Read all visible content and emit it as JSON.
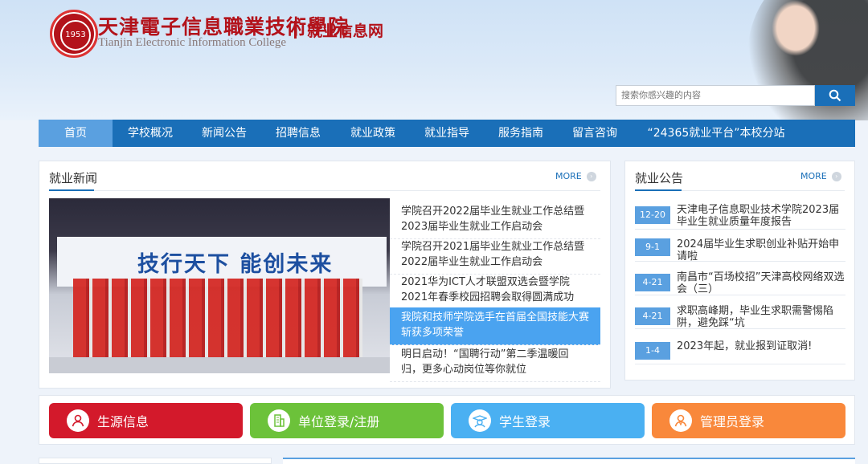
{
  "header": {
    "title_cn": "天津電子信息職業技術學院",
    "title_en": "Tianjin Electronic Information College",
    "subtitle": "就业信息网",
    "logo_year": "1953"
  },
  "search": {
    "placeholder": "搜索你感兴趣的内容",
    "icon": "search-icon"
  },
  "nav": {
    "items": [
      {
        "label": "首页",
        "active": true
      },
      {
        "label": "学校概况"
      },
      {
        "label": "新闻公告"
      },
      {
        "label": "招聘信息"
      },
      {
        "label": "就业政策"
      },
      {
        "label": "就业指导"
      },
      {
        "label": "服务指南"
      },
      {
        "label": "留言咨询"
      },
      {
        "label": "“24365就业平台”本校分站"
      }
    ]
  },
  "news": {
    "title": "就业新闻",
    "more": "MORE",
    "photo_banner": "技行天下 能创未来",
    "items": [
      "学院召开2022届毕业生就业工作总结暨2023届毕业生就业工作启动会",
      "学院召开2021届毕业生就业工作总结暨2022届毕业生就业工作启动会",
      "2021华为ICT人才联盟双选会暨学院2021年春季校园招聘会取得圆满成功",
      "我院和技师学院选手在首届全国技能大赛斩获多项荣誉",
      "明日启动！“国聘行动”第二季温暖回归，更多心动岗位等你就位"
    ]
  },
  "announcements": {
    "title": "就业公告",
    "more": "MORE",
    "items": [
      {
        "date": "12-20",
        "text": "天津电子信息职业技术学院2023届毕业生就业质量年度报告"
      },
      {
        "date": "9-1",
        "text": "2024届毕业生求职创业补贴开始申请啦"
      },
      {
        "date": "4-21",
        "text": "南昌市“百场校招”天津高校网络双选会（三）"
      },
      {
        "date": "4-21",
        "text": "求职高峰期，毕业生求职需警惕陷阱，避免踩“坑"
      },
      {
        "date": "1-4",
        "text": "2023年起，就业报到证取消!"
      }
    ]
  },
  "actions": [
    {
      "label": "生源信息",
      "color": "#d3192b",
      "icon": "student-source-icon"
    },
    {
      "label": "单位登录/注册",
      "color": "#6cc23a",
      "icon": "building-icon"
    },
    {
      "label": "学生登录",
      "color": "#4ab0f2",
      "icon": "graduate-icon"
    },
    {
      "label": "管理员登录",
      "color": "#f9883b",
      "icon": "admin-icon"
    }
  ],
  "colors": {
    "nav_bg": "#1a6fb8",
    "nav_active": "#5aa0e0",
    "brand_red": "#b3131b"
  }
}
